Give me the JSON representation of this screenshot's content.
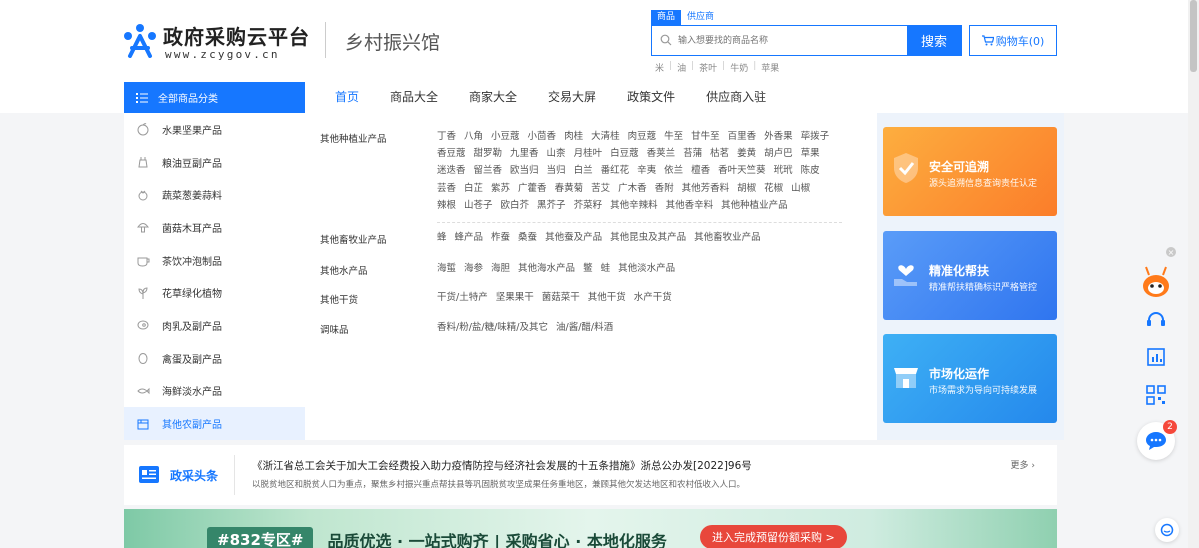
{
  "brand": {
    "title": "政府采购云平台",
    "domain": "www.zcygov.cn",
    "hall": "乡村振兴馆"
  },
  "search": {
    "tabs": [
      "商品",
      "供应商"
    ],
    "placeholder": "输入想要找的商品名称",
    "button": "搜索",
    "cart": "购物车(0)",
    "hot_words": [
      "米",
      "油",
      "茶叶",
      "牛奶",
      "苹果"
    ]
  },
  "nav": {
    "all_categories": "全部商品分类",
    "items": [
      "首页",
      "商品大全",
      "商家大全",
      "交易大屏",
      "政策文件",
      "供应商入驻"
    ]
  },
  "categories": [
    {
      "label": "水果坚果产品",
      "icon": "fruit-icon"
    },
    {
      "label": "粮油豆副产品",
      "icon": "grain-icon"
    },
    {
      "label": "蔬菜葱姜蒜料",
      "icon": "vegetable-icon"
    },
    {
      "label": "菌菇木耳产品",
      "icon": "mushroom-icon"
    },
    {
      "label": "茶饮冲泡制品",
      "icon": "tea-icon"
    },
    {
      "label": "花草绿化植物",
      "icon": "plant-icon"
    },
    {
      "label": "肉乳及副产品",
      "icon": "meat-icon"
    },
    {
      "label": "禽蛋及副产品",
      "icon": "egg-icon"
    },
    {
      "label": "海鲜淡水产品",
      "icon": "seafood-icon"
    },
    {
      "label": "其他农副产品",
      "icon": "box-icon"
    }
  ],
  "mega_menu": [
    {
      "title": "其他种植业产品",
      "links": [
        "丁香",
        "八角",
        "小豆蔻",
        "小茴香",
        "肉桂",
        "大清桂",
        "肉豆蔻",
        "牛至",
        "甘牛至",
        "百里香",
        "外香果",
        "荜拨子",
        "香豆蔻",
        "甜罗勒",
        "九里香",
        "山柰",
        "月桂叶",
        "白豆蔻",
        "香荚兰",
        "苔蒲",
        "枯茗",
        "姜黄",
        "胡卢巴",
        "草果",
        "迷迭香",
        "留兰香",
        "欧当归",
        "当归",
        "白兰",
        "番红花",
        "辛夷",
        "依兰",
        "檀香",
        "香叶天竺葵",
        "玳玳",
        "陈皮",
        "芸香",
        "白芷",
        "紫苏",
        "广藿香",
        "春黄菊",
        "苦艾",
        "广木香",
        "香附",
        "其他芳香料",
        "胡椒",
        "花椒",
        "山椒",
        "辣根",
        "山苍子",
        "欧白芥",
        "黑芥子",
        "芥菜籽",
        "其他辛辣料",
        "其他香辛料",
        "其他种植业产品"
      ]
    },
    {
      "title": "其他畜牧业产品",
      "links": [
        "蜂",
        "蜂产品",
        "柞蚕",
        "桑蚕",
        "其他蚕及产品",
        "其他昆虫及其产品",
        "其他畜牧业产品"
      ]
    },
    {
      "title": "其他水产品",
      "links": [
        "海蜇",
        "海参",
        "海胆",
        "其他海水产品",
        "鳖",
        "蛙",
        "其他淡水产品"
      ]
    },
    {
      "title": "其他干货",
      "links": [
        "干货/土特产",
        "坚果果干",
        "菌菇菜干",
        "其他干货",
        "水产干货"
      ]
    },
    {
      "title": "调味品",
      "links": [
        "香料/粉/盐/糖/味精/及其它",
        "油/酱/醋/料酒"
      ]
    }
  ],
  "promos": [
    {
      "title": "安全可追溯",
      "desc": "源头追溯信息查询责任认定",
      "icon": "shield-icon",
      "color": "#fb8b2c"
    },
    {
      "title": "精准化帮扶",
      "desc": "精准帮扶精确标识严格管控",
      "icon": "hand-heart-icon",
      "color": "#3f88f5"
    },
    {
      "title": "市场化运作",
      "desc": "市场需求为导向可持续发展",
      "icon": "store-icon",
      "color": "#2f9cf0"
    }
  ],
  "headline": {
    "brand": "政采头条",
    "title": "《浙江省总工会关于加大工会经费投入助力疫情防控与经济社会发展的十五条措施》浙总公办发[2022]96号",
    "desc": "以脱贫地区和脱贫人口为重点，聚焦乡村振兴重点帮扶县等巩固脱贫攻坚成果任务重地区，兼顾其他欠发达地区和农村低收入人口。",
    "more": "更多"
  },
  "banner": {
    "tag": "#832专区#",
    "slogan": "品质优选 · 一站式购齐 | 采购省心 · 本地化服务",
    "cta": "进入完成预留份额采购 >"
  },
  "float": {
    "badge": "2"
  },
  "colors": {
    "accent": "#1677ff"
  }
}
